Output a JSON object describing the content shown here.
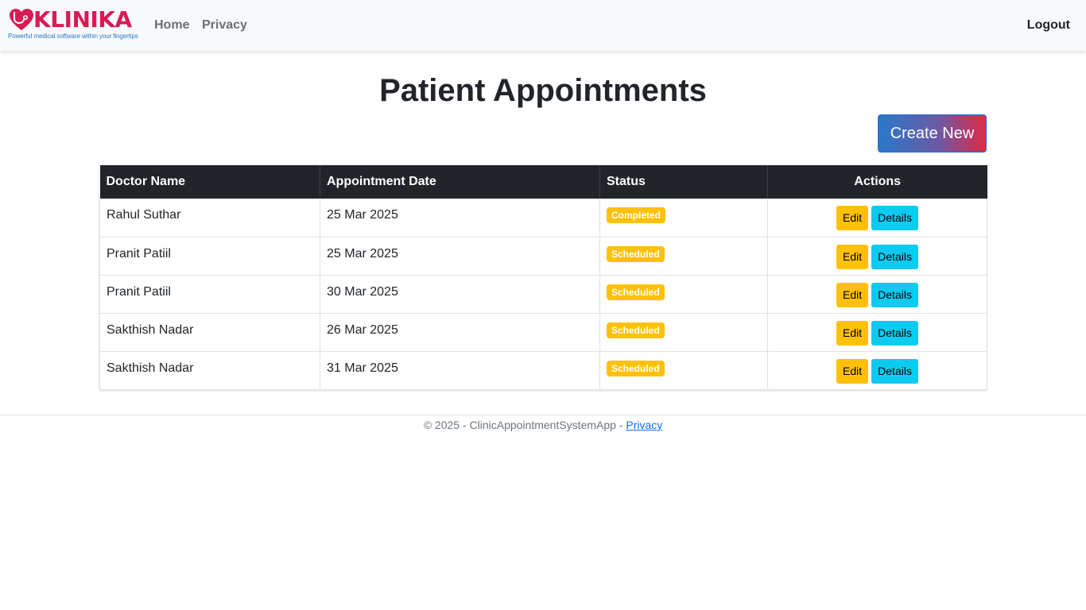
{
  "brand": {
    "name": "KLINIKA",
    "tagline": "Powerful medical software within your fingertips",
    "colors": {
      "primary": "#d91a55",
      "secondary": "#2a7cc7"
    }
  },
  "nav": {
    "home": "Home",
    "privacy": "Privacy",
    "logout": "Logout"
  },
  "page": {
    "title": "Patient Appointments",
    "create_button": "Create New"
  },
  "table": {
    "headers": {
      "doctor": "Doctor Name",
      "date": "Appointment Date",
      "status": "Status",
      "actions": "Actions"
    },
    "rows": [
      {
        "doctor": "Rahul Suthar",
        "date": "25 Mar 2025",
        "status": "Completed",
        "edit": "Edit",
        "details": "Details"
      },
      {
        "doctor": "Pranit Patiil",
        "date": "25 Mar 2025",
        "status": "Scheduled",
        "edit": "Edit",
        "details": "Details"
      },
      {
        "doctor": "Pranit Patiil",
        "date": "30 Mar 2025",
        "status": "Scheduled",
        "edit": "Edit",
        "details": "Details"
      },
      {
        "doctor": "Sakthish Nadar",
        "date": "26 Mar 2025",
        "status": "Scheduled",
        "edit": "Edit",
        "details": "Details"
      },
      {
        "doctor": "Sakthish Nadar",
        "date": "31 Mar 2025",
        "status": "Scheduled",
        "edit": "Edit",
        "details": "Details"
      }
    ]
  },
  "footer": {
    "text": "© 2025 - ClinicAppointmentSystemApp - ",
    "privacy_link": "Privacy"
  },
  "colors": {
    "header_bg": "#212529",
    "badge": "#ffc107",
    "edit_button": "#ffc107",
    "details_button": "#0dcaf0",
    "link": "#0d6efd"
  }
}
